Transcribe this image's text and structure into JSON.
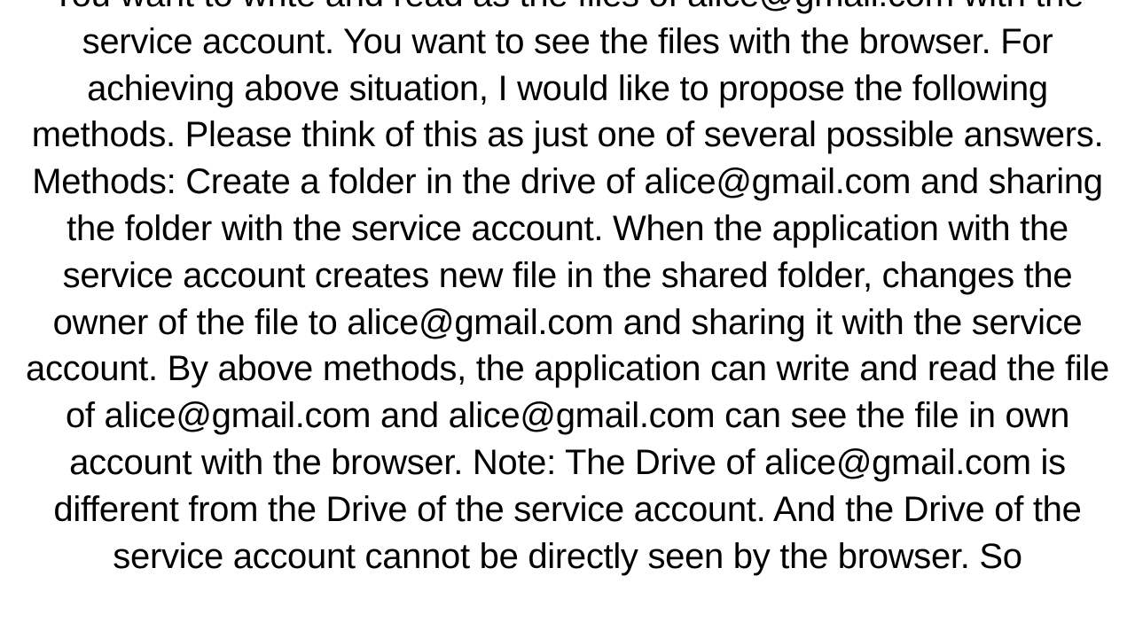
{
  "document": {
    "body_text": "You want to write and read as the files of alice@gmail.com with the service account. You want to see the files with the browser.  For achieving above situation, I would like to propose the following methods. Please think of this as just one of several possible answers. Methods:  Create a folder in the drive of alice@gmail.com and sharing the folder with the service account. When the application with the service account creates new file in the shared folder, changes the owner of the file to alice@gmail.com and sharing it with the service account.  By above methods, the application can write and read the file of alice@gmail.com and alice@gmail.com can see the file in own account with the browser. Note:  The Drive of alice@gmail.com is different from the Drive of the service account. And the Drive of the service account cannot be directly seen by the browser. So"
  }
}
